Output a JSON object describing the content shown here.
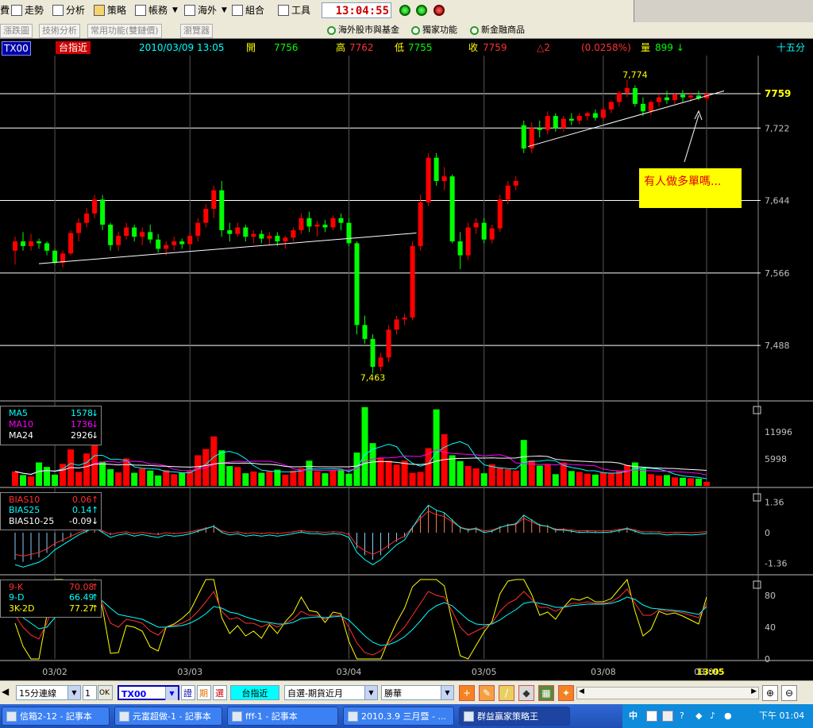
{
  "toolbar": {
    "items": [
      {
        "label": "費",
        "icon": "bill-icon"
      },
      {
        "label": "走勢",
        "icon": "trend-icon"
      },
      {
        "label": "分析",
        "icon": "analysis-icon"
      },
      {
        "label": "策略",
        "icon": "strategy-icon"
      },
      {
        "label": "帳務",
        "icon": "account-icon"
      },
      {
        "label": "海外",
        "icon": "overseas-icon"
      },
      {
        "label": "組合",
        "icon": "combo-icon"
      },
      {
        "label": "工具",
        "icon": "tools-icon"
      }
    ],
    "clock": "13:04:55"
  },
  "tabs": [
    "漲跌圖",
    "技術分析",
    "常用功能(雙鏈價)",
    "瀏覽器"
  ],
  "links": [
    "海外股市與基金",
    "獨家功能",
    "新金融商品"
  ],
  "info": {
    "symbol": "TX00",
    "name": "台指近",
    "datetime": "2010/03/09 13:05",
    "open_label": "開",
    "open": "7756",
    "high_label": "高",
    "high": "7762",
    "low_label": "低",
    "low": "7755",
    "close_label": "收",
    "close": "7759",
    "change": "△2",
    "change_pct": "(0.0258%)",
    "vol_label": "量",
    "vol": "899 ↓",
    "period": "十五分"
  },
  "price_axis": {
    "current": "7759",
    "ticks": [
      "7,722",
      "7,644",
      "7,566",
      "7,488"
    ],
    "high_mark": "7,774",
    "low_mark": "7,463"
  },
  "note": "有人做多單嗎...",
  "volume": {
    "labels": [
      {
        "name": "MA5",
        "value": "1578",
        "arrow": "↓",
        "color": "#00ffff"
      },
      {
        "name": "MA10",
        "value": "1736",
        "arrow": "↓",
        "color": "#ff00ff"
      },
      {
        "name": "MA24",
        "value": "2926",
        "arrow": "↓",
        "color": "#ffffff"
      }
    ],
    "ticks": [
      "11996",
      "5998"
    ]
  },
  "bias": {
    "labels": [
      {
        "name": "BIAS10",
        "value": "0.06",
        "arrow": "↑",
        "color": "#ff3030"
      },
      {
        "name": "BIAS25",
        "value": "0.14",
        "arrow": "↑",
        "color": "#00ffff"
      },
      {
        "name": "BIAS10-25",
        "value": "-0.09",
        "arrow": "↓",
        "color": "#ffffff"
      }
    ],
    "ticks": [
      "1.36",
      "0",
      "-1.36"
    ]
  },
  "kd": {
    "labels": [
      {
        "name": "9-K",
        "value": "70.08",
        "arrow": "↑",
        "color": "#ff3030"
      },
      {
        "name": "9-D",
        "value": "66.49",
        "arrow": "↑",
        "color": "#00ffff"
      },
      {
        "name": "3K-2D",
        "value": "77.27",
        "arrow": "↑",
        "color": "#ffff00"
      }
    ],
    "ticks": [
      "80",
      "40",
      "0"
    ]
  },
  "dates": [
    "03/02",
    "03/03",
    "03/04",
    "03/05",
    "03/08",
    "03/09",
    "13:05"
  ],
  "bottom": {
    "interval": "15分連線",
    "spin": "1",
    "ok": "OK",
    "symbol": "TX00",
    "b1": "證",
    "b2": "期",
    "b3": "選",
    "name": "台指近",
    "category": "自選-期貨近月",
    "broker": "勝華"
  },
  "taskbar": {
    "tasks": [
      "信箱2-12 - 記事本",
      "元富超做-1 - 記事本",
      "fff-1 - 記事本",
      "2010.3.9 三月暨 - ...",
      "群益贏家策略王"
    ],
    "lang": "中",
    "time": "下午 01:04"
  },
  "colors": {
    "up": "#ff0000",
    "down": "#00ff00",
    "grid": "#ffffff",
    "axis_text": "#c0c0c0"
  },
  "chart_data": {
    "type": "candlestick",
    "price_range": [
      7430,
      7800
    ],
    "candles": [
      [
        7590,
        7605,
        7575,
        7600
      ],
      [
        7600,
        7610,
        7590,
        7595
      ],
      [
        7595,
        7608,
        7590,
        7600
      ],
      [
        7600,
        7603,
        7592,
        7598
      ],
      [
        7598,
        7600,
        7585,
        7590
      ],
      [
        7590,
        7592,
        7575,
        7577
      ],
      [
        7577,
        7590,
        7572,
        7587
      ],
      [
        7587,
        7612,
        7585,
        7609
      ],
      [
        7609,
        7625,
        7600,
        7620
      ],
      [
        7620,
        7636,
        7615,
        7630
      ],
      [
        7630,
        7650,
        7625,
        7645
      ],
      [
        7645,
        7650,
        7612,
        7618
      ],
      [
        7618,
        7620,
        7590,
        7596
      ],
      [
        7596,
        7610,
        7590,
        7606
      ],
      [
        7606,
        7620,
        7602,
        7615
      ],
      [
        7615,
        7618,
        7600,
        7605
      ],
      [
        7605,
        7615,
        7596,
        7610
      ],
      [
        7610,
        7618,
        7598,
        7602
      ],
      [
        7602,
        7608,
        7588,
        7592
      ],
      [
        7592,
        7600,
        7585,
        7596
      ],
      [
        7596,
        7605,
        7590,
        7600
      ],
      [
        7600,
        7603,
        7592,
        7597
      ],
      [
        7597,
        7610,
        7594,
        7606
      ],
      [
        7606,
        7625,
        7600,
        7620
      ],
      [
        7620,
        7640,
        7615,
        7635
      ],
      [
        7635,
        7660,
        7625,
        7655
      ],
      [
        7655,
        7665,
        7605,
        7612
      ],
      [
        7612,
        7620,
        7600,
        7608
      ],
      [
        7608,
        7620,
        7605,
        7615
      ],
      [
        7615,
        7618,
        7600,
        7605
      ],
      [
        7605,
        7612,
        7598,
        7608
      ],
      [
        7608,
        7612,
        7598,
        7603
      ],
      [
        7603,
        7610,
        7596,
        7606
      ],
      [
        7606,
        7610,
        7595,
        7600
      ],
      [
        7600,
        7606,
        7592,
        7604
      ],
      [
        7604,
        7615,
        7600,
        7612
      ],
      [
        7612,
        7630,
        7608,
        7625
      ],
      [
        7625,
        7632,
        7610,
        7616
      ],
      [
        7616,
        7622,
        7605,
        7618
      ],
      [
        7618,
        7623,
        7610,
        7615
      ],
      [
        7615,
        7628,
        7612,
        7625
      ],
      [
        7625,
        7630,
        7612,
        7620
      ],
      [
        7620,
        7625,
        7595,
        7598
      ],
      [
        7598,
        7600,
        7500,
        7510
      ],
      [
        7510,
        7520,
        7490,
        7495
      ],
      [
        7495,
        7500,
        7458,
        7465
      ],
      [
        7465,
        7480,
        7460,
        7475
      ],
      [
        7475,
        7510,
        7470,
        7505
      ],
      [
        7505,
        7520,
        7500,
        7516
      ],
      [
        7516,
        7522,
        7510,
        7518
      ],
      [
        7518,
        7600,
        7515,
        7595
      ],
      [
        7595,
        7650,
        7590,
        7642
      ],
      [
        7642,
        7695,
        7638,
        7690
      ],
      [
        7690,
        7695,
        7660,
        7665
      ],
      [
        7665,
        7680,
        7655,
        7670
      ],
      [
        7670,
        7672,
        7598,
        7600
      ],
      [
        7600,
        7610,
        7570,
        7585
      ],
      [
        7585,
        7620,
        7580,
        7615
      ],
      [
        7615,
        7625,
        7608,
        7620
      ],
      [
        7620,
        7625,
        7598,
        7602
      ],
      [
        7602,
        7618,
        7598,
        7614
      ],
      [
        7614,
        7650,
        7610,
        7645
      ],
      [
        7645,
        7665,
        7640,
        7660
      ],
      [
        7660,
        7670,
        7655,
        7665
      ],
      [
        7725,
        7730,
        7695,
        7700
      ],
      [
        7700,
        7728,
        7695,
        7722
      ],
      [
        7722,
        7730,
        7712,
        7720
      ],
      [
        7720,
        7740,
        7715,
        7735
      ],
      [
        7735,
        7738,
        7718,
        7722
      ],
      [
        7722,
        7735,
        7718,
        7732
      ],
      [
        7732,
        7738,
        7725,
        7730
      ],
      [
        7730,
        7738,
        7726,
        7735
      ],
      [
        7735,
        7740,
        7730,
        7738
      ],
      [
        7738,
        7742,
        7730,
        7733
      ],
      [
        7733,
        7745,
        7730,
        7742
      ],
      [
        7742,
        7752,
        7738,
        7750
      ],
      [
        7750,
        7762,
        7745,
        7760
      ],
      [
        7760,
        7774,
        7755,
        7765
      ],
      [
        7765,
        7768,
        7745,
        7748
      ],
      [
        7748,
        7755,
        7735,
        7740
      ],
      [
        7740,
        7752,
        7736,
        7750
      ],
      [
        7750,
        7758,
        7745,
        7755
      ],
      [
        7755,
        7762,
        7748,
        7752
      ],
      [
        7752,
        7760,
        7748,
        7758
      ],
      [
        7758,
        7763,
        7750,
        7755
      ],
      [
        7755,
        7760,
        7750,
        7757
      ],
      [
        7757,
        7762,
        7752,
        7754
      ],
      [
        7754,
        7760,
        7750,
        7759
      ]
    ],
    "volume_range": [
      0,
      18000
    ],
    "volume": [
      3200,
      2400,
      2100,
      5200,
      4200,
      2500,
      4900,
      8100,
      3100,
      7200,
      10200,
      5400,
      3700,
      3000,
      6100,
      2900,
      3800,
      3400,
      2300,
      3500,
      2600,
      2900,
      3300,
      6800,
      8200,
      11000,
      7900,
      4400,
      4200,
      2800,
      3200,
      2900,
      3300,
      3600,
      2500,
      3400,
      3900,
      5600,
      3200,
      2800,
      3500,
      3600,
      2700,
      7400,
      17500,
      9500,
      6300,
      5600,
      4700,
      5600,
      2900,
      3100,
      8400,
      17000,
      11500,
      6800,
      5500,
      4400,
      3900,
      2800,
      4800,
      4100,
      3700,
      3400,
      10200,
      5700,
      4500,
      4800,
      2600,
      5200,
      3300,
      3100,
      2700,
      2500,
      3000,
      2800,
      3300,
      4600,
      5200,
      3800,
      2600,
      2300,
      2400,
      1900,
      1800,
      1700,
      1600,
      900
    ],
    "bias_range": [
      -1.8,
      1.8
    ],
    "bias": [
      -1.2,
      -1.3,
      -1.2,
      -1.1,
      -0.9,
      -0.6,
      -0.4,
      -0.2,
      0,
      0.15,
      0.3,
      0.1,
      -0.1,
      0,
      0.05,
      -0.05,
      0.02,
      -0.05,
      -0.1,
      0,
      -0.05,
      -0.02,
      0.05,
      0.15,
      0.25,
      0.35,
      0.1,
      0.0,
      0.05,
      -0.05,
      0,
      -0.05,
      0,
      -0.05,
      0,
      0.05,
      0.12,
      0.05,
      0.05,
      0.02,
      0.05,
      0.03,
      -0.1,
      -0.7,
      -1.0,
      -1.2,
      -1.0,
      -0.7,
      -0.4,
      -0.2,
      0.3,
      0.8,
      1.2,
      1.0,
      0.9,
      0.6,
      0.3,
      0.2,
      0.25,
      0.1,
      0.15,
      0.3,
      0.4,
      0.45,
      0.8,
      0.6,
      0.4,
      0.35,
      0.2,
      0.2,
      0.15,
      0.1,
      0.12,
      0.1,
      0.1,
      0.12,
      0.18,
      0.25,
      0.15,
      0.05,
      0.05,
      0.05,
      0.0,
      0.03,
      0.02,
      0.0,
      0.02,
      0.06
    ],
    "kd_range": [
      0,
      100
    ],
    "k": [
      55,
      40,
      30,
      25,
      45,
      75,
      85,
      70,
      60,
      75,
      90,
      70,
      45,
      40,
      50,
      48,
      45,
      35,
      30,
      40,
      42,
      45,
      50,
      60,
      72,
      85,
      60,
      50,
      52,
      45,
      45,
      40,
      45,
      40,
      45,
      50,
      60,
      55,
      55,
      50,
      55,
      55,
      40,
      20,
      8,
      5,
      10,
      20,
      30,
      40,
      55,
      70,
      85,
      80,
      78,
      60,
      40,
      30,
      35,
      40,
      45,
      60,
      70,
      75,
      85,
      75,
      65,
      65,
      60,
      65,
      70,
      70,
      72,
      70,
      70,
      72,
      78,
      88,
      70,
      55,
      55,
      62,
      60,
      60,
      58,
      55,
      52,
      70
    ],
    "d": [
      60,
      52,
      45,
      38,
      40,
      52,
      63,
      65,
      63,
      67,
      75,
      73,
      64,
      56,
      54,
      52,
      50,
      45,
      40,
      40,
      41,
      42,
      45,
      50,
      57,
      66,
      64,
      59,
      57,
      53,
      50,
      47,
      46,
      44,
      44,
      46,
      51,
      52,
      53,
      52,
      53,
      54,
      49,
      39,
      29,
      21,
      17,
      18,
      22,
      28,
      37,
      48,
      60,
      67,
      71,
      67,
      58,
      49,
      44,
      43,
      44,
      49,
      56,
      62,
      70,
      72,
      70,
      68,
      65,
      65,
      67,
      68,
      69,
      69,
      69,
      70,
      73,
      78,
      75,
      68,
      64,
      63,
      62,
      61,
      60,
      58,
      56,
      66
    ]
  }
}
